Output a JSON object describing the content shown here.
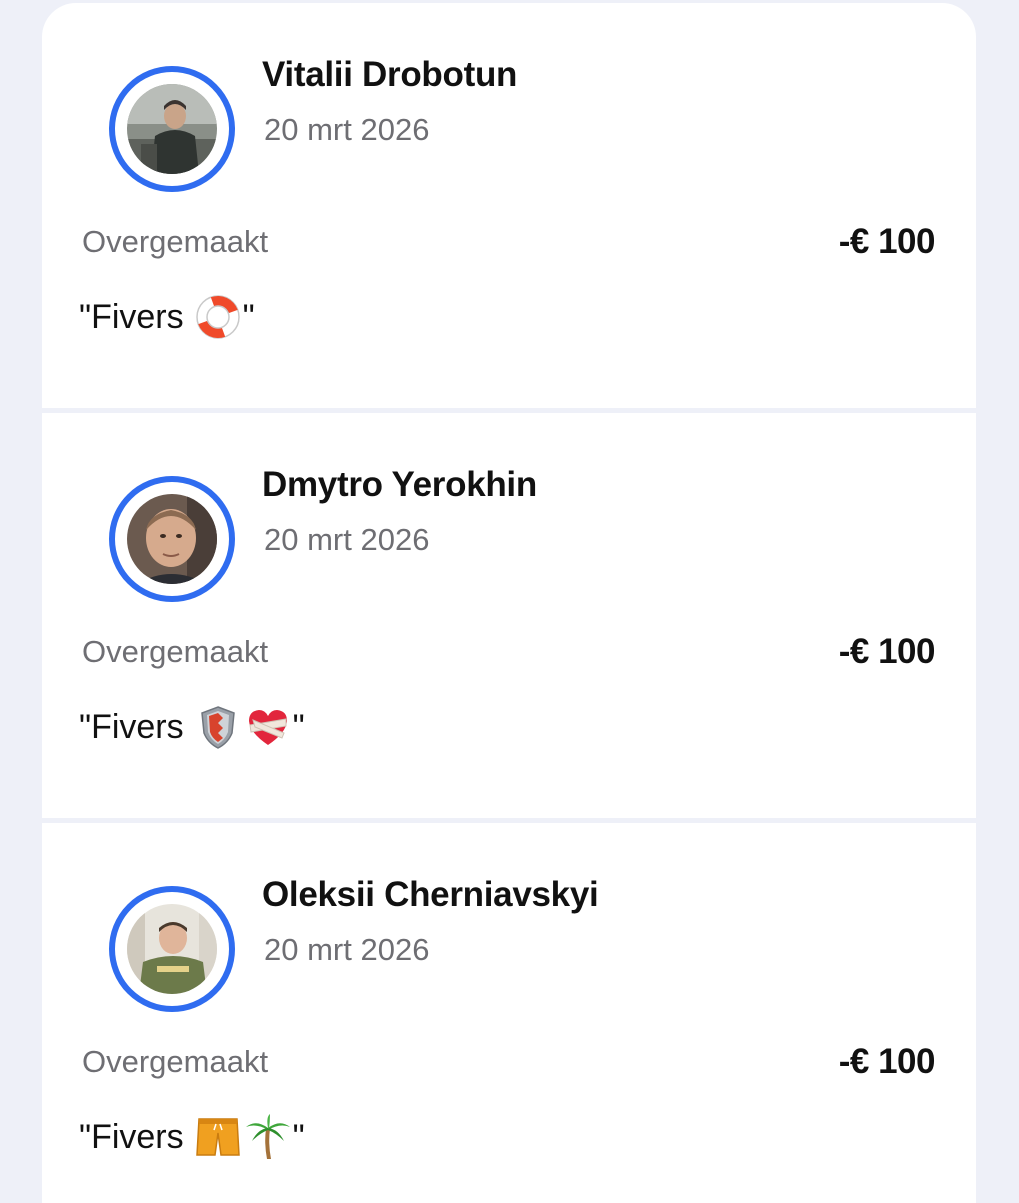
{
  "transactions": [
    {
      "name": "Vitalii Drobotun",
      "date": "20 mrt 2026",
      "status": "Overgemaakt",
      "amount": "-€ 100",
      "memo_open": "\"Fivers",
      "memo_close": "\"",
      "memo_emojis": [
        "life-buoy-icon"
      ]
    },
    {
      "name": "Dmytro Yerokhin",
      "date": "20 mrt 2026",
      "status": "Overgemaakt",
      "amount": "-€ 100",
      "memo_open": "\"Fivers",
      "memo_close": "\"",
      "memo_emojis": [
        "shield-icon",
        "mending-heart-icon"
      ]
    },
    {
      "name": "Oleksii Cherniavskyi",
      "date": "20 mrt 2026",
      "status": "Overgemaakt",
      "amount": "-€ 100",
      "memo_open": "\"Fivers",
      "memo_close": "\"",
      "memo_emojis": [
        "shorts-icon",
        "palm-tree-icon"
      ]
    }
  ],
  "colors": {
    "accent_ring": "#2f6cf0",
    "background": "#eef0f8",
    "card": "#ffffff",
    "muted_text": "#6e6e73"
  }
}
